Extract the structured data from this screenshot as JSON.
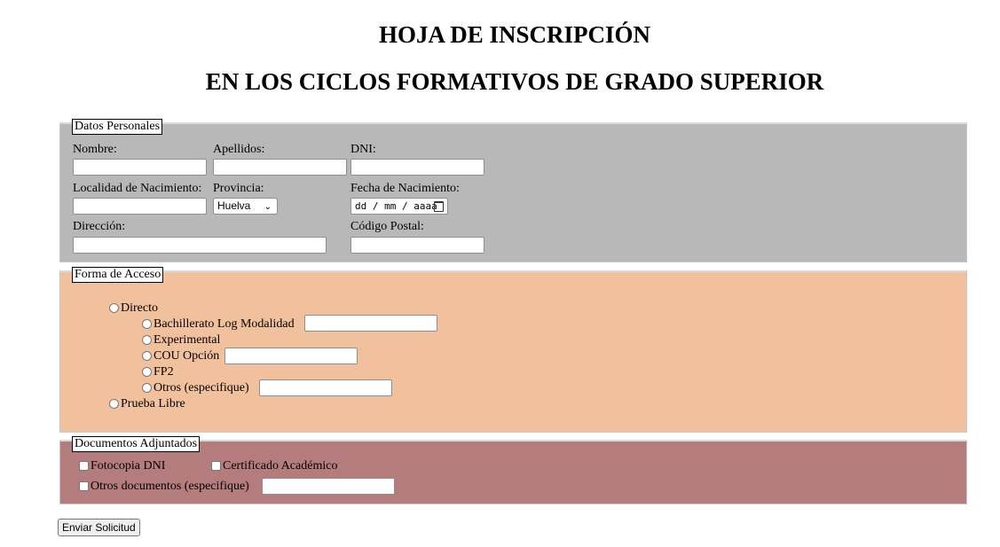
{
  "page": {
    "title_line1": "HOJA DE INSCRIPCIÓN",
    "title_line2": "EN LOS CICLOS FORMATIVOS DE GRADO SUPERIOR"
  },
  "personal": {
    "legend": "Datos Personales",
    "bg_color": "#b8b8b8",
    "nombre_label": "Nombre:",
    "apellidos_label": "Apellidos:",
    "dni_label": "DNI:",
    "localidad_label": "Localidad de Nacimiento:",
    "provincia_label": "Provincia:",
    "provincia_value": "Huelva",
    "fecha_label": "Fecha de Nacimiento:",
    "fecha_placeholder": "dd / mm / aaaa",
    "direccion_label": "Dirección:",
    "cp_label": "Código Postal:"
  },
  "acceso": {
    "legend": "Forma de Acceso",
    "bg_color": "#f0c19c",
    "directo": "Directo",
    "bachillerato": "Bachillerato Log Modalidad",
    "experimental": "Experimental",
    "cou": "COU Opción",
    "fp2": "FP2",
    "otros": "Otros (especifique)",
    "prueba_libre": "Prueba Libre"
  },
  "documentos": {
    "legend": "Documentos Adjuntados",
    "bg_color": "#b47c7c",
    "fotocopia_dni": "Fotocopia DNI",
    "certificado": "Certificado Académico",
    "otros_docs": "Otros documentos (especifique)"
  },
  "submit_label": "Enviar Solicitud"
}
